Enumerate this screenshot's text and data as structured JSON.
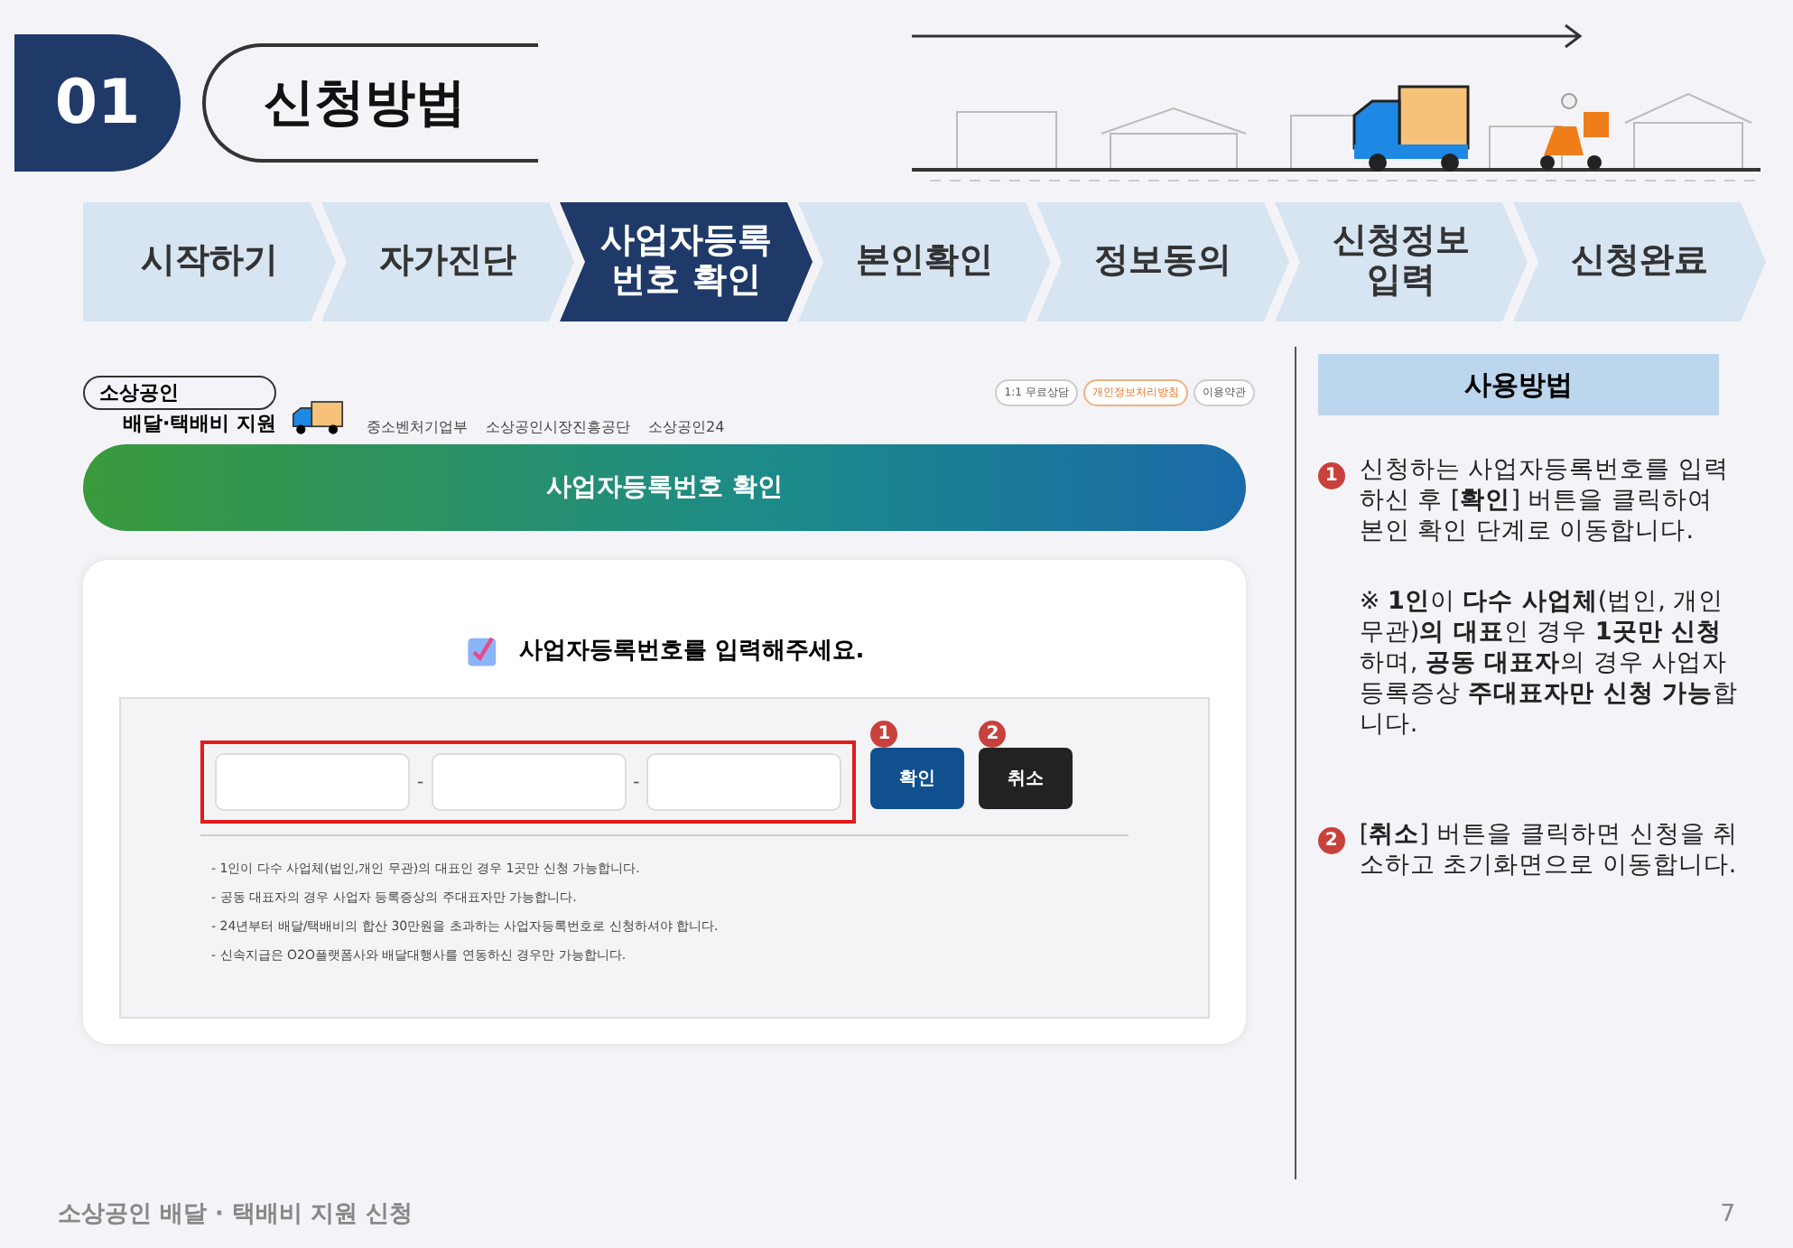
{
  "section_number": "01",
  "section_title": "신청방법",
  "steps": [
    {
      "label": "시작하기",
      "selected": false
    },
    {
      "label": "자가진단",
      "selected": false
    },
    {
      "label": "사업자등록\n번호 확인",
      "selected": true
    },
    {
      "label": "본인확인",
      "selected": false
    },
    {
      "label": "정보동의",
      "selected": false
    },
    {
      "label": "신청정보\n입력",
      "selected": false
    },
    {
      "label": "신청완료",
      "selected": false
    }
  ],
  "screenshot": {
    "logo_top": "소상공인",
    "logo_bottom": "배달·택배비 지원",
    "agencies": [
      "중소벤처기업부",
      "소상공인시장진흥공단",
      "소상공인24"
    ],
    "pills": [
      {
        "label": "1:1 무료상담",
        "highlighted": false
      },
      {
        "label": "개인정보처리방침",
        "highlighted": true
      },
      {
        "label": "이용약관",
        "highlighted": false
      }
    ],
    "banner": "사업자등록번호 확인",
    "prompt": "사업자등록번호를 입력해주세요.",
    "separators": [
      "-",
      "-"
    ],
    "buttons": [
      {
        "label": "확인",
        "badge": "1",
        "kind": "primary"
      },
      {
        "label": "취소",
        "badge": "2",
        "kind": "dark"
      }
    ],
    "notes": [
      "- 1인이 다수 사업체(법인,개인 무관)의 대표인 경우 1곳만 신청 가능합니다.",
      "- 공동 대표자의 경우 사업자 등록증상의 주대표자만 가능합니다.",
      "- 24년부터 배달/택배비의 합산 30만원을 초과하는 사업자등록번호로 신청하셔야 합니다.",
      "- 신속지급은 O2O플랫폼사와 배달대행사를 연동하신 경우만 가능합니다."
    ]
  },
  "guide": {
    "title": "사용방법",
    "items": [
      {
        "badge": "1",
        "paragraphs": [
          "신청하는 사업자등록번호를 입력하신 후 [**확인**] 버튼을 클릭하여 본인 확인 단계로 이동합니다.",
          "※ **1인**이 **다수 사업체**(법인, 개인 무관)**의 대표**인 경우 **1곳만 신청**하며, **공동 대표자**의 경우 사업자등록증상 **주대표자만 신청 가능**합니다."
        ]
      },
      {
        "badge": "2",
        "paragraphs": [
          "[**취소**] 버튼을 클릭하면 신청을 취소하고 초기화면으로 이동합니다."
        ]
      }
    ]
  },
  "footer": "소상공인 배달 · 택배비 지원 신청",
  "page_number": "7"
}
